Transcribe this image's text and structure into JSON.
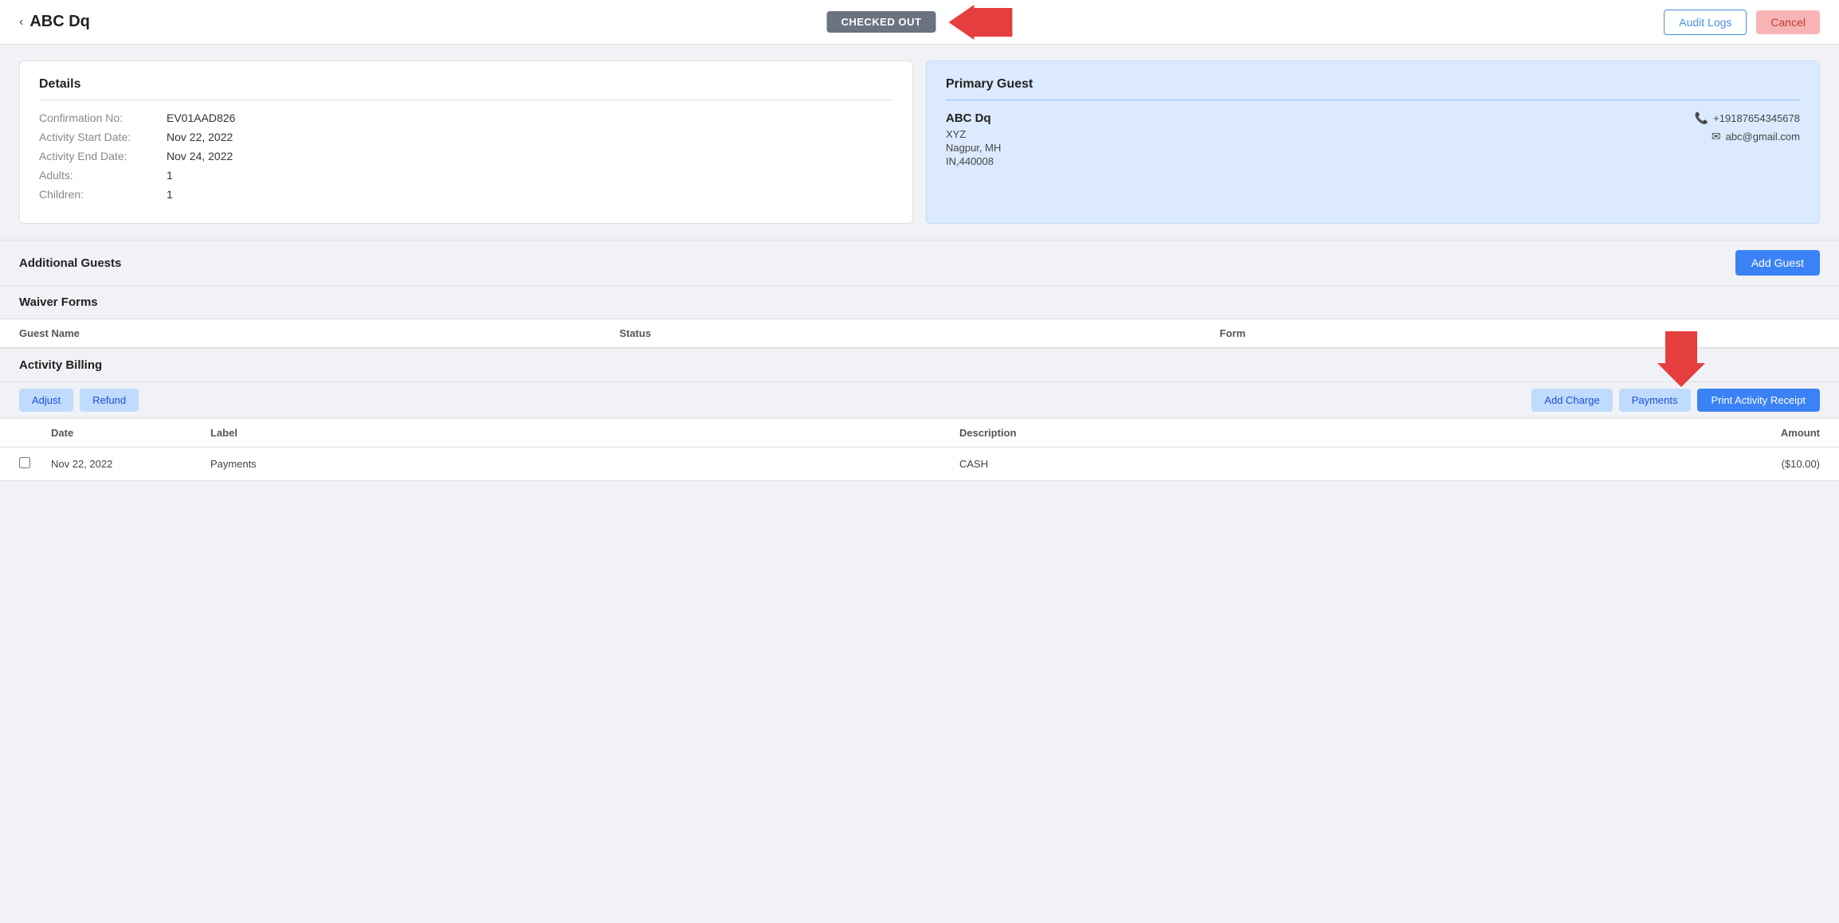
{
  "header": {
    "back_label": "‹",
    "title": "ABC  Dq",
    "status_badge": "CHECKED OUT",
    "audit_logs_label": "Audit Logs",
    "cancel_label": "Cancel"
  },
  "details": {
    "section_title": "Details",
    "fields": [
      {
        "label": "Confirmation No:",
        "value": "EV01AAD826"
      },
      {
        "label": "Activity Start Date:",
        "value": "Nov 22, 2022"
      },
      {
        "label": "Activity End Date:",
        "value": "Nov 24, 2022"
      },
      {
        "label": "Adults:",
        "value": "1"
      },
      {
        "label": "Children:",
        "value": "1"
      }
    ]
  },
  "primary_guest": {
    "section_title": "Primary Guest",
    "name": "ABC  Dq",
    "company": "XYZ",
    "city_state": "Nagpur, MH",
    "country_zip": "IN,440008",
    "phone": "+19187654345678",
    "email": "abc@gmail.com"
  },
  "additional_guests": {
    "section_title": "Additional Guests",
    "add_guest_label": "Add Guest"
  },
  "waiver_forms": {
    "section_title": "Waiver Forms",
    "columns": [
      "Guest Name",
      "Status",
      "Form"
    ],
    "rows": []
  },
  "activity_billing": {
    "section_title": "Activity Billing",
    "btn_adjust": "Adjust",
    "btn_refund": "Refund",
    "btn_add_charge": "Add Charge",
    "btn_payments": "Payments",
    "btn_print_receipt": "Print Activity Receipt",
    "columns": [
      "",
      "Date",
      "Label",
      "Description",
      "Amount"
    ],
    "rows": [
      {
        "checked": false,
        "date": "Nov 22, 2022",
        "label": "Payments",
        "description": "CASH",
        "amount": "($10.00)"
      }
    ]
  }
}
